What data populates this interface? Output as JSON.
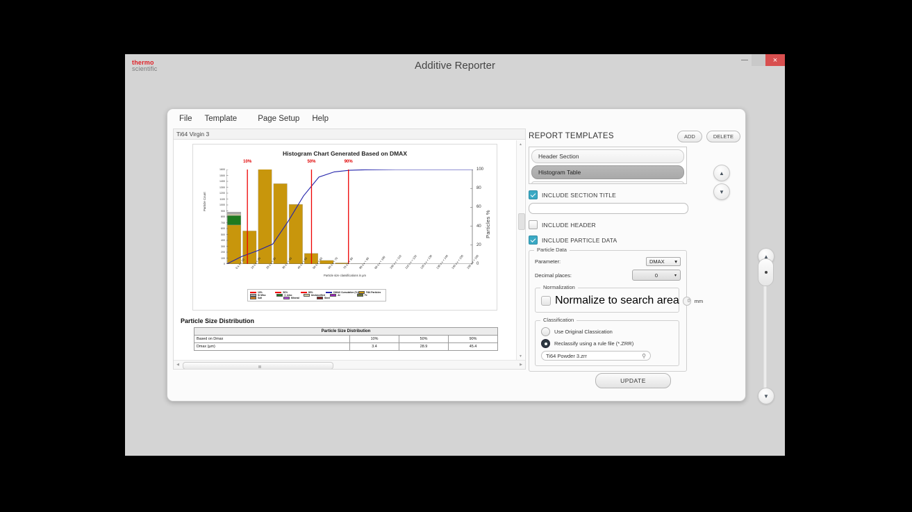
{
  "window": {
    "title": "Additive Reporter",
    "brand_line1": "thermo",
    "brand_line2": "scientific",
    "minimize": "—",
    "maximize": "□",
    "close": "×"
  },
  "menubar": {
    "items": [
      "File",
      "Template",
      "Page Setup",
      "Help"
    ]
  },
  "document": {
    "file_tab": "Ti64 Virgin 3",
    "section_heading": "Particle Size Distribution",
    "table": {
      "title": "Particle Size Distribution",
      "rows": [
        {
          "label": "Based on Dmax",
          "values": [
            "10%",
            "50%",
            "90%"
          ]
        },
        {
          "label": "Dmax (µm)",
          "values": [
            "3.4",
            "28.9",
            "45.4"
          ]
        }
      ]
    }
  },
  "chart_data": {
    "type": "bar",
    "title": "Histogram Chart Generated Based on DMAX",
    "xlabel": "Particle size classifications in µm",
    "ylabel": "Particle Count",
    "y2label": "Particles %",
    "ylim": [
      0,
      1600
    ],
    "y2lim": [
      0,
      100
    ],
    "yticks": [
      0,
      100,
      200,
      300,
      400,
      500,
      600,
      700,
      800,
      900,
      1000,
      1100,
      1200,
      1300,
      1400,
      1500,
      1600
    ],
    "y2ticks": [
      0,
      20,
      40,
      60,
      80,
      100
    ],
    "grid": false,
    "legend_position": "bottom",
    "categories": [
      "0 ≤ x < 10",
      "10 ≤ x < 20",
      "20 ≤ x < 30",
      "30 ≤ x < 40",
      "40 ≤ x < 50",
      "50 ≤ x < 60",
      "60 ≤ x < 70",
      "70 ≤ x < 80",
      "80 ≤ x < 90",
      "90 ≤ x < 100",
      "100 ≤ x < 110",
      "110 ≤ x < 120",
      "120 ≤ x < 130",
      "130 ≤ x < 140",
      "140 ≤ x < 150",
      "150 ≤ x < 160"
    ],
    "series": [
      {
        "name": "Ti64 Particles",
        "color": "#c8960c",
        "values": [
          660,
          560,
          1620,
          1360,
          1010,
          180,
          60,
          18,
          6,
          2,
          0,
          0,
          0,
          0,
          0,
          0
        ]
      },
      {
        "name": "C misc",
        "color": "#1f7a1f",
        "values": [
          160,
          0,
          0,
          0,
          0,
          0,
          0,
          0,
          0,
          0,
          0,
          0,
          0,
          0,
          0,
          0
        ]
      },
      {
        "name": "Unclassified",
        "color": "#d6cba5",
        "values": [
          25,
          0,
          0,
          0,
          0,
          0,
          0,
          0,
          0,
          0,
          0,
          0,
          0,
          0,
          0,
          0
        ]
      },
      {
        "name": "Si Misc",
        "color": "#a8a8a8",
        "values": [
          35,
          0,
          0,
          0,
          0,
          0,
          0,
          0,
          0,
          0,
          0,
          0,
          0,
          0,
          0,
          0
        ]
      }
    ],
    "cumulative": {
      "name": "DMAX Cumulative (%)",
      "color": "#2222aa",
      "values": [
        8,
        14,
        21,
        45,
        72,
        92,
        97.5,
        99.2,
        99.7,
        99.9,
        100,
        100,
        100,
        100,
        100,
        100
      ]
    },
    "percentile_markers": [
      {
        "label": "10%",
        "x_frac": 0.085,
        "color": "#ee0000"
      },
      {
        "label": "50%",
        "x_frac": 0.345,
        "color": "#ee0000"
      },
      {
        "label": "90%",
        "x_frac": 0.495,
        "color": "#ee0000"
      }
    ],
    "legend": [
      {
        "label": "10%",
        "color": "#ee0000",
        "kind": "line"
      },
      {
        "label": "50%",
        "color": "#ee0000",
        "kind": "line"
      },
      {
        "label": "90%",
        "color": "#ee0000",
        "kind": "line"
      },
      {
        "label": "DMAX Cumulative (%)",
        "color": "#2222aa",
        "kind": "line"
      },
      {
        "label": "Ti64 Particles",
        "color": "#c8960c",
        "kind": "box"
      },
      {
        "label": "Si Misc",
        "color": "#a8a8a8",
        "kind": "box"
      },
      {
        "label": "C misc",
        "color": "#1f7a1f",
        "kind": "box"
      },
      {
        "label": "Unclassified",
        "color": "#d6cba5",
        "kind": "box"
      },
      {
        "label": "Al",
        "color": "#a020c0",
        "kind": "box"
      },
      {
        "label": "Fe",
        "color": "#6b7a33",
        "kind": "box"
      },
      {
        "label": "Salt",
        "color": "#e0821a",
        "kind": "box"
      },
      {
        "label": "Mineral",
        "color": "#b84fe0",
        "kind": "box"
      },
      {
        "label": "Steel",
        "color": "#8b1a1a",
        "kind": "box"
      }
    ]
  },
  "report_templates": {
    "title": "REPORT TEMPLATES",
    "add_label": "ADD",
    "delete_label": "DELETE",
    "items": [
      {
        "label": "Header Section",
        "selected": false
      },
      {
        "label": "Histogram Table",
        "selected": true
      }
    ]
  },
  "options": {
    "include_section_title": {
      "label": "INCLUDE SECTION TITLE",
      "checked": true
    },
    "section_title_value": "",
    "include_header": {
      "label": "INCLUDE HEADER",
      "checked": false
    },
    "include_particle_data": {
      "label": "INCLUDE PARTICLE DATA",
      "checked": true
    }
  },
  "particle_data": {
    "group_title": "Particle Data",
    "parameter_label": "Parameter:",
    "parameter_value": "DMAX",
    "decimal_label": "Decimal places:",
    "decimal_value": "0",
    "normalization": {
      "group_title": "Normalization",
      "checkbox_label": "Normalize to search area",
      "checked": false,
      "value": "0",
      "unit": "mm"
    },
    "classification": {
      "group_title": "Classification",
      "option_original": "Use Original Classication",
      "option_rule": "Reclassify using a rule file (*.ZRR)",
      "selected": "rule",
      "rule_file": "Ti64 Powder 3.zrr",
      "browse_icon": "search-icon"
    }
  },
  "update_button": "UPDATE",
  "nav": {
    "up_arrow": "▲",
    "down_arrow": "▼"
  }
}
